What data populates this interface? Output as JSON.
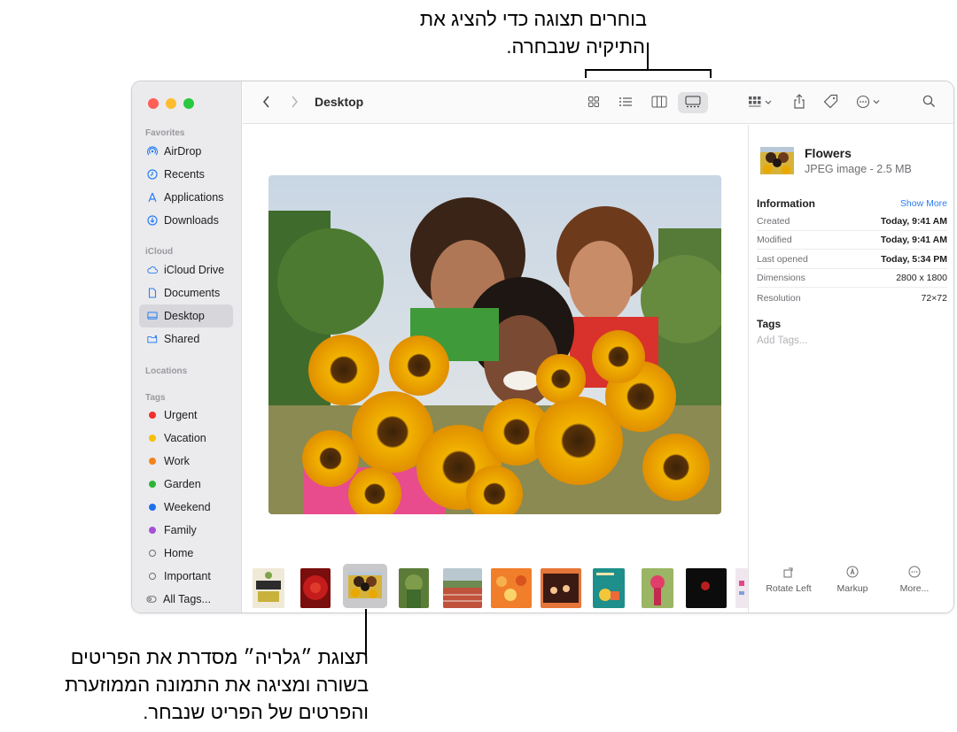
{
  "callouts": {
    "top_line1": "בוחרים תצוגה כדי להציג את",
    "top_line2": "התיקיה שנבחרה.",
    "bottom_line1": "תצוגת ״גלריה״ מסדרת את הפריטים",
    "bottom_line2": "בשורה ומציגה את התמונה הממוזערת",
    "bottom_line3": "והפרטים של הפריט שנבחר."
  },
  "sidebar": {
    "favorites_title": "Favorites",
    "favorites": [
      {
        "label": "AirDrop",
        "icon": "airdrop-icon"
      },
      {
        "label": "Recents",
        "icon": "clock-icon"
      },
      {
        "label": "Applications",
        "icon": "applications-icon"
      },
      {
        "label": "Downloads",
        "icon": "download-icon"
      }
    ],
    "icloud_title": "iCloud",
    "icloud": [
      {
        "label": "iCloud Drive",
        "icon": "cloud-icon"
      },
      {
        "label": "Documents",
        "icon": "document-icon"
      },
      {
        "label": "Desktop",
        "icon": "desktop-icon"
      },
      {
        "label": "Shared",
        "icon": "shared-folder-icon"
      }
    ],
    "locations_title": "Locations",
    "tags_title": "Tags",
    "tags": [
      {
        "label": "Urgent",
        "color": "#f5302b"
      },
      {
        "label": "Vacation",
        "color": "#f5c000"
      },
      {
        "label": "Work",
        "color": "#f7821b"
      },
      {
        "label": "Garden",
        "color": "#2cb534"
      },
      {
        "label": "Weekend",
        "color": "#1f6ff0"
      },
      {
        "label": "Family",
        "color": "#a550d6"
      },
      {
        "label": "Home",
        "color": ""
      },
      {
        "label": "Important",
        "color": ""
      },
      {
        "label": "All Tags...",
        "color": ""
      }
    ]
  },
  "toolbar": {
    "title": "Desktop",
    "back_icon": "chevron-left-icon",
    "forward_icon": "chevron-right-icon"
  },
  "inspector": {
    "file_name": "Flowers",
    "file_kind": "JPEG image - 2.5 MB",
    "information_title": "Information",
    "show_more": "Show More",
    "rows": [
      {
        "key": "Created",
        "value": "Today, 9:41 AM"
      },
      {
        "key": "Modified",
        "value": "Today, 9:41 AM"
      },
      {
        "key": "Last opened",
        "value": "Today, 5:34 PM"
      },
      {
        "key": "Dimensions",
        "value": "2800 x 1800"
      },
      {
        "key": "Resolution",
        "value": "72×72"
      }
    ],
    "tags_title": "Tags",
    "tags_placeholder": "Add Tags...",
    "actions": [
      {
        "label": "Rotate Left",
        "icon": "rotate-left-icon"
      },
      {
        "label": "Markup",
        "icon": "markup-icon"
      },
      {
        "label": "More...",
        "icon": "more-icon"
      }
    ]
  },
  "colors": {
    "accent": "#2a7ef2",
    "close": "#fe5f57",
    "minimize": "#febc2e",
    "zoom": "#28c840"
  }
}
